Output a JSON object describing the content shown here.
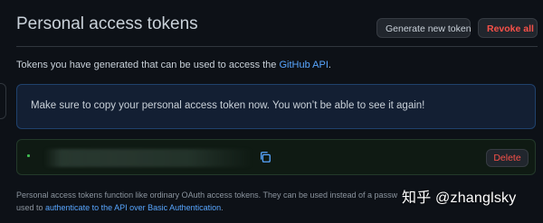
{
  "header": {
    "title": "Personal access tokens",
    "generate_label": "Generate new token",
    "revoke_label": "Revoke all"
  },
  "intro": {
    "text": "Tokens you have generated that can be used to access the ",
    "link": "GitHub API",
    "suffix": "."
  },
  "flash": {
    "text": "Make sure to copy your personal access token now. You won’t be able to see it again!"
  },
  "token": {
    "delete_label": "Delete"
  },
  "footer": {
    "line1": "Personal access tokens function like ordinary OAuth access tokens. They can be used instead of a passw",
    "line2_prefix": "used to ",
    "line2_link": "authenticate to the API over Basic Authentication",
    "line2_suffix": "."
  },
  "watermark": {
    "text": "知乎 @zhanglsky"
  },
  "colors": {
    "background": "#0d1117",
    "link": "#58a6ff",
    "danger": "#f85149",
    "success": "#3fb950"
  }
}
